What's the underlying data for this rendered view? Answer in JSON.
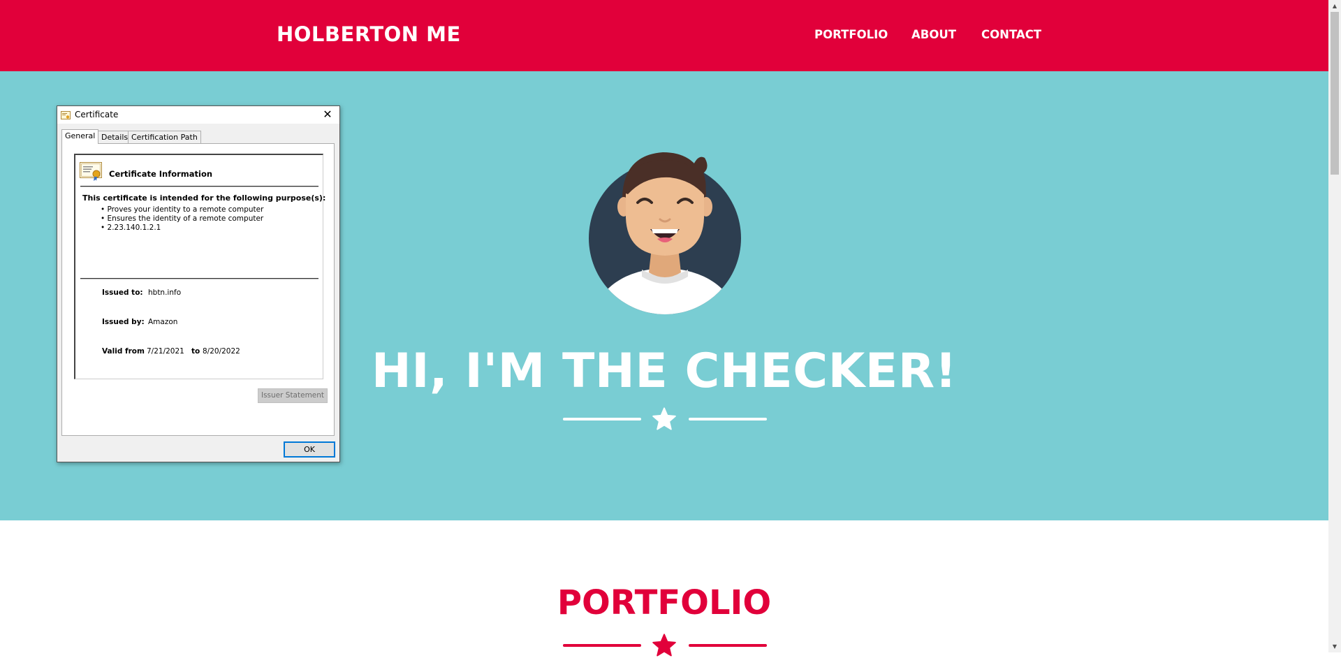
{
  "navbar": {
    "brand": "HOLBERTON ME",
    "links": [
      "PORTFOLIO",
      "ABOUT",
      "CONTACT"
    ]
  },
  "hero": {
    "title": "HI, I'M THE CHECKER!"
  },
  "portfolio": {
    "title": "PORTFOLIO"
  },
  "dialog": {
    "title": "Certificate",
    "tabs": [
      "General",
      "Details",
      "Certification Path"
    ],
    "active_tab": "General",
    "info_heading": "Certificate Information",
    "purpose_title": "This certificate is intended for the following purpose(s):",
    "purposes": [
      "Proves your identity to a remote computer",
      "Ensures the identity of a remote computer",
      "2.23.140.1.2.1"
    ],
    "issued_to_label": "Issued to:",
    "issued_to": "hbtn.info",
    "issued_by_label": "Issued by:",
    "issued_by": "Amazon",
    "valid_from_label": "Valid from",
    "valid_from": "7/21/2021",
    "valid_to_label": "to",
    "valid_to": "8/20/2022",
    "issuer_statement": "Issuer Statement",
    "ok": "OK"
  },
  "colors": {
    "brand_red": "#e1003a",
    "hero_teal": "#79cdd3",
    "avatar_bg": "#2d3e50",
    "text_white": "#ffffff"
  },
  "icons": [
    "close-icon",
    "certificate-icon",
    "star-icon",
    "scroll-up-icon",
    "scroll-down-icon"
  ]
}
